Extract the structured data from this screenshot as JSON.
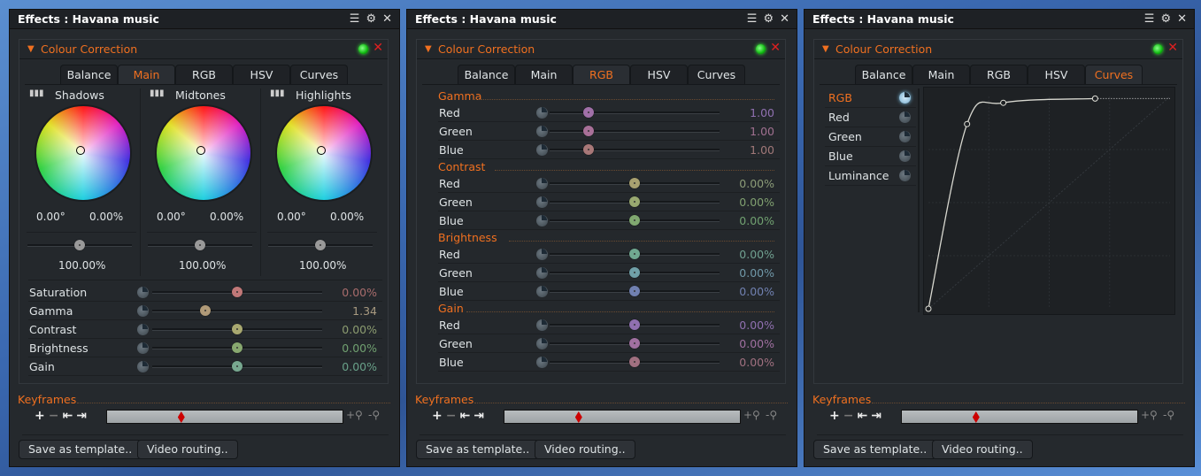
{
  "panels": [
    {
      "title": "Effects : Havana music",
      "section": "Colour Correction",
      "active_tab": 1,
      "tabs": [
        "Balance",
        "Main",
        "RGB",
        "HSV",
        "Curves"
      ],
      "view": "main",
      "wheels": [
        {
          "label": "Shadows",
          "angle": "0.00°",
          "amount": "0.00%",
          "level": "100.00%",
          "level_pos": 0.5
        },
        {
          "label": "Midtones",
          "angle": "0.00°",
          "amount": "0.00%",
          "level": "100.00%",
          "level_pos": 0.5
        },
        {
          "label": "Highlights",
          "angle": "0.00°",
          "amount": "0.00%",
          "level": "100.00%",
          "level_pos": 0.5
        }
      ],
      "rows": [
        {
          "label": "Saturation",
          "value": "0.00%",
          "pos": 0.5,
          "knob": "#c07878",
          "color": "#a86c6c"
        },
        {
          "label": "Gamma",
          "value": "1.34",
          "pos": 0.31,
          "knob": "#b09a78",
          "color": "#a89a80"
        },
        {
          "label": "Contrast",
          "value": "0.00%",
          "pos": 0.5,
          "knob": "#a8a870",
          "color": "#8c9c70"
        },
        {
          "label": "Brightness",
          "value": "0.00%",
          "pos": 0.5,
          "knob": "#88a870",
          "color": "#70a070"
        },
        {
          "label": "Gain",
          "value": "0.00%",
          "pos": 0.5,
          "knob": "#78a890",
          "color": "#68a088"
        }
      ]
    },
    {
      "title": "Effects : Havana music",
      "section": "Colour Correction",
      "active_tab": 2,
      "tabs": [
        "Balance",
        "Main",
        "RGB",
        "HSV",
        "Curves"
      ],
      "view": "rgb",
      "groups": [
        {
          "label": "Gamma",
          "rows": [
            {
              "label": "Red",
              "value": "1.00",
              "pos": 0.23,
              "knob": "#a070a8",
              "color": "#9070b0"
            },
            {
              "label": "Green",
              "value": "1.00",
              "pos": 0.23,
              "knob": "#a87098",
              "color": "#a07090"
            },
            {
              "label": "Blue",
              "value": "1.00",
              "pos": 0.23,
              "knob": "#a87878",
              "color": "#a07878"
            }
          ]
        },
        {
          "label": "Contrast",
          "rows": [
            {
              "label": "Red",
              "value": "0.00%",
              "pos": 0.5,
              "knob": "#a8a070",
              "color": "#8c9c78"
            },
            {
              "label": "Green",
              "value": "0.00%",
              "pos": 0.5,
              "knob": "#98a870",
              "color": "#80a070"
            },
            {
              "label": "Blue",
              "value": "0.00%",
              "pos": 0.5,
              "knob": "#80a870",
              "color": "#70a070"
            }
          ]
        },
        {
          "label": "Brightness",
          "rows": [
            {
              "label": "Red",
              "value": "0.00%",
              "pos": 0.5,
              "knob": "#70a890",
              "color": "#70a090"
            },
            {
              "label": "Green",
              "value": "0.00%",
              "pos": 0.5,
              "knob": "#70a0a8",
              "color": "#7098a8"
            },
            {
              "label": "Blue",
              "value": "0.00%",
              "pos": 0.5,
              "knob": "#7080b0",
              "color": "#7080b0"
            }
          ]
        },
        {
          "label": "Gain",
          "rows": [
            {
              "label": "Red",
              "value": "0.00%",
              "pos": 0.5,
              "knob": "#9070b0",
              "color": "#9070b0"
            },
            {
              "label": "Green",
              "value": "0.00%",
              "pos": 0.5,
              "knob": "#a070a0",
              "color": "#a070a0"
            },
            {
              "label": "Blue",
              "value": "0.00%",
              "pos": 0.5,
              "knob": "#a07080",
              "color": "#a07080"
            }
          ]
        }
      ]
    },
    {
      "title": "Effects : Havana music",
      "section": "Colour Correction",
      "active_tab": 4,
      "tabs": [
        "Balance",
        "Main",
        "RGB",
        "HSV",
        "Curves"
      ],
      "view": "curves",
      "channels": [
        "RGB",
        "Red",
        "Green",
        "Blue",
        "Luminance"
      ],
      "selected_channel": 0,
      "curve_points": [
        [
          0,
          0
        ],
        [
          0.16,
          0.87
        ],
        [
          0.31,
          0.97
        ],
        [
          0.69,
          0.99
        ]
      ]
    }
  ],
  "keyframes": {
    "label": "Keyframes",
    "add": "+",
    "remove": "−",
    "prev": "⇤",
    "next": "⇥",
    "zoom_in": "+⚲",
    "zoom_out": "-⚲",
    "marker_pos": 0.3
  },
  "buttons": {
    "save_template": "Save as template..",
    "video_routing": "Video routing.."
  },
  "colors": {
    "accent": "#f07020",
    "panel": "#25292d",
    "enabled_led": "#22cc22",
    "close": "#e02020"
  }
}
